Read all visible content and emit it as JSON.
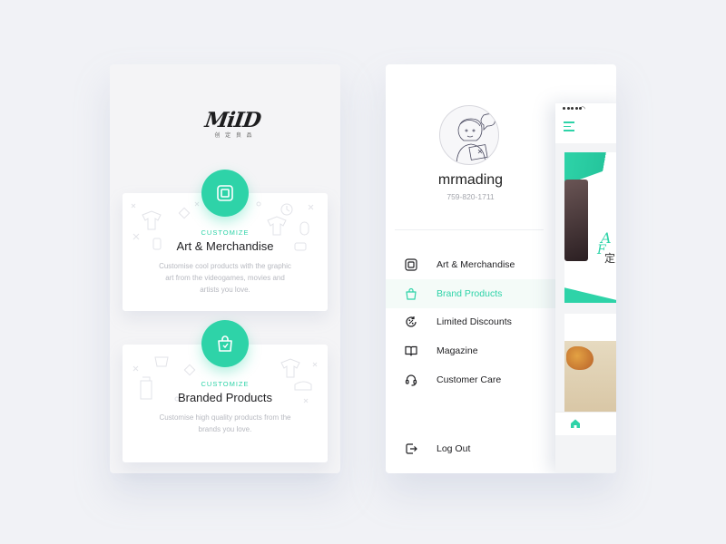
{
  "left": {
    "logo_text": "MiID",
    "logo_sub": "创 定 良 品",
    "cards": [
      {
        "kicker": "CUSTOMIZE",
        "title": "Art & Merchandise",
        "desc": "Customise cool products with the graphic art from the videogames, movies and artists you love.",
        "icon": "square-frame-icon"
      },
      {
        "kicker": "CUSTOMIZE",
        "title": "Branded Products",
        "desc": "Customise high quality products from the brands you love.",
        "icon": "shopping-bag-icon"
      }
    ]
  },
  "right": {
    "username": "mrmading",
    "phone": "759-820-1711",
    "menu": [
      {
        "label": "Art & Merchandise",
        "icon": "square-frame-icon",
        "active": false
      },
      {
        "label": "Brand Products",
        "icon": "shopping-bag-icon",
        "active": true
      },
      {
        "label": "Limited Discounts",
        "icon": "discount-icon",
        "active": false
      },
      {
        "label": "Magazine",
        "icon": "book-icon",
        "active": false
      },
      {
        "label": "Customer Care",
        "icon": "headset-icon",
        "active": false
      }
    ],
    "logout": "Log Out",
    "peek": {
      "banner_text": "A",
      "banner_text2": "F",
      "banner_text3": "定"
    }
  },
  "colors": {
    "accent": "#2ed3a8",
    "background": "#f1f2f6",
    "text": "#1f1f22",
    "muted": "#b7b9c0"
  }
}
